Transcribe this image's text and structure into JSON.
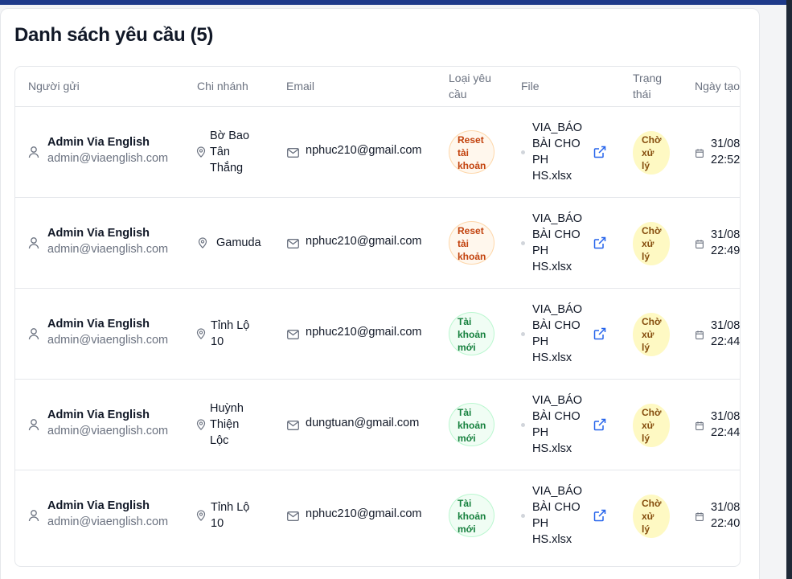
{
  "page": {
    "title": "Danh sách yêu cầu (5)"
  },
  "colors": {
    "accent_top_bar": "#1e3a8a",
    "reset_badge_bg": "#fff7ed",
    "reset_badge_text": "#c2410c",
    "new_badge_bg": "#f0fdf4",
    "new_badge_text": "#15803d",
    "pending_badge_bg": "#fef9c3",
    "pending_badge_text": "#854d0e",
    "link_blue": "#2563eb"
  },
  "table": {
    "headers": {
      "sender": "Người gửi",
      "branch": "Chi nhánh",
      "email": "Email",
      "type_line1": "Loại yêu",
      "type_line2": "cầu",
      "file": "File",
      "status_line1": "Trạng",
      "status_line2": "thái",
      "created": "Ngày tạo"
    },
    "rows": [
      {
        "sender_name": "Admin Via English",
        "sender_email": "admin@viaenglish.com",
        "branch_lines": [
          "Bờ Bao",
          "Tân",
          "Thắng"
        ],
        "email": "nphuc210@gmail.com",
        "type_kind": "reset",
        "type_lines": [
          "Reset",
          "tài",
          "khoản"
        ],
        "file_lines": [
          "VIA_BÁO",
          "BÀI CHO",
          "PH",
          "HS.xlsx"
        ],
        "status_lines": [
          "Chờ",
          "xử",
          "lý"
        ],
        "date_line1": "31/08",
        "date_line2": "22:52"
      },
      {
        "sender_name": "Admin Via English",
        "sender_email": "admin@viaenglish.com",
        "branch_lines": [
          "Gamuda"
        ],
        "email": "nphuc210@gmail.com",
        "type_kind": "reset",
        "type_lines": [
          "Reset",
          "tài",
          "khoản"
        ],
        "file_lines": [
          "VIA_BÁO",
          "BÀI CHO",
          "PH",
          "HS.xlsx"
        ],
        "status_lines": [
          "Chờ",
          "xử",
          "lý"
        ],
        "date_line1": "31/08",
        "date_line2": "22:49"
      },
      {
        "sender_name": "Admin Via English",
        "sender_email": "admin@viaenglish.com",
        "branch_lines": [
          "Tỉnh Lộ",
          "10"
        ],
        "email": "nphuc210@gmail.com",
        "type_kind": "new",
        "type_lines": [
          "Tài",
          "khoản",
          "mới"
        ],
        "file_lines": [
          "VIA_BÁO",
          "BÀI CHO",
          "PH",
          "HS.xlsx"
        ],
        "status_lines": [
          "Chờ",
          "xử",
          "lý"
        ],
        "date_line1": "31/08",
        "date_line2": "22:44"
      },
      {
        "sender_name": "Admin Via English",
        "sender_email": "admin@viaenglish.com",
        "branch_lines": [
          "Huỳnh",
          "Thiện",
          "Lộc"
        ],
        "email": "dungtuan@gmail.com",
        "type_kind": "new",
        "type_lines": [
          "Tài",
          "khoản",
          "mới"
        ],
        "file_lines": [
          "VIA_BÁO",
          "BÀI CHO",
          "PH",
          "HS.xlsx"
        ],
        "status_lines": [
          "Chờ",
          "xử",
          "lý"
        ],
        "date_line1": "31/08",
        "date_line2": "22:44"
      },
      {
        "sender_name": "Admin Via English",
        "sender_email": "admin@viaenglish.com",
        "branch_lines": [
          "Tỉnh Lộ",
          "10"
        ],
        "email": "nphuc210@gmail.com",
        "type_kind": "new",
        "type_lines": [
          "Tài",
          "khoản",
          "mới"
        ],
        "file_lines": [
          "VIA_BÁO",
          "BÀI CHO",
          "PH",
          "HS.xlsx"
        ],
        "status_lines": [
          "Chờ",
          "xử",
          "lý"
        ],
        "date_line1": "31/08",
        "date_line2": "22:40"
      }
    ]
  }
}
